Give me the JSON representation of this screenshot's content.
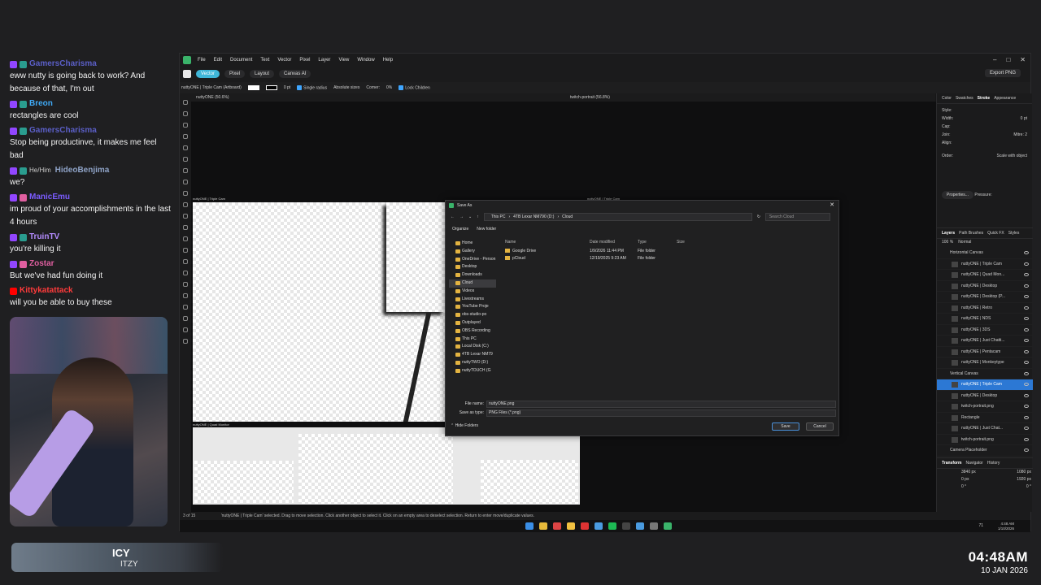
{
  "chat": [
    {
      "user": "GamersCharisma",
      "color": "#5b5fc7",
      "badges": [
        "twitch",
        "sub"
      ],
      "text": "eww nutty is going back to work? And because of that, I'm out"
    },
    {
      "user": "Breon",
      "color": "#3fa9f5",
      "badges": [
        "twitch",
        "sub"
      ],
      "text": "rectangles are cool"
    },
    {
      "user": "GamersCharisma",
      "color": "#5b5fc7",
      "badges": [
        "twitch",
        "sub"
      ],
      "text": "Stop being productinve, it makes me feel bad"
    },
    {
      "user": "HideoBenjima",
      "color": "#8fa3c7",
      "pronoun": "He/Him",
      "badges": [
        "twitch",
        "sub"
      ],
      "text": "we?"
    },
    {
      "user": "ManicEmu",
      "color": "#7b5cff",
      "badges": [
        "twitch",
        "pr"
      ],
      "text": "im proud of your accomplishments in the last 4 hours"
    },
    {
      "user": "TruinTV",
      "color": "#b48cff",
      "badges": [
        "twitch",
        "sub"
      ],
      "text": "you're killing it"
    },
    {
      "user": "Zostar",
      "color": "#e05fa0",
      "badges": [
        "twitch",
        "pr"
      ],
      "text": "But we've had fun doing it"
    },
    {
      "user": "Kittykatattack",
      "color": "#ff3b3b",
      "badges": [
        "yt"
      ],
      "text": "will you be able to buy these"
    }
  ],
  "now_playing": {
    "title": "ICY",
    "artist": "ITZY"
  },
  "clock": {
    "time": "04:48AM",
    "date": "10 JAN 2026"
  },
  "app": {
    "menu": [
      "File",
      "Edit",
      "Document",
      "Text",
      "Vector",
      "Pixel",
      "Layer",
      "View",
      "Window",
      "Help"
    ],
    "personas": [
      "Vector",
      "Pixel",
      "Layout",
      "Canvas AI"
    ],
    "export_label": "Export PNG",
    "context": {
      "selection": "nuttyONE | Triple Cam (Artboard)",
      "stroke": "0 pt",
      "single_radius": "Single radius",
      "absolute_sizes": "Absolute sizes",
      "corner": "Corner:",
      "pct": "0%",
      "lock_children": "Lock Children"
    },
    "tabs": [
      "nuttyONE (50.6%)",
      "twitch-portrait (56.8%)"
    ],
    "artboard_labels": [
      "nuttyONE | Triple Cam",
      "nuttyONE | Triple Cam",
      "nuttyONE | Quad Monitor"
    ],
    "right_tabs_top": [
      "Color",
      "Swatches",
      "Stroke",
      "Appearance"
    ],
    "right_tabs_layers": [
      "Layers",
      "Path Brushes",
      "Quick FX",
      "Styles"
    ],
    "stroke_panel": {
      "style": "Style:",
      "width": "Width:",
      "width_val": "0 pt",
      "cap": "Cap:",
      "join": "Join:",
      "mitre": "Mitre:",
      "mitre_val": "2",
      "align": "Align:",
      "order": "Order:",
      "scale": "Scale with object",
      "properties": "Properties...",
      "pressure": "Pressure:"
    },
    "layers_opacity": "100 %",
    "layers_blend": "Normal",
    "layers": [
      {
        "name": "Horizontal Canvas",
        "group": true,
        "selected": false
      },
      {
        "name": "nuttyONE | Triple Cam",
        "group": false,
        "selected": false
      },
      {
        "name": "nuttyONE | Quad Mon...",
        "group": false,
        "selected": false
      },
      {
        "name": "nuttyONE | Desktop",
        "group": false,
        "selected": false
      },
      {
        "name": "nuttyONE | Desktop (P...",
        "group": false,
        "selected": false
      },
      {
        "name": "nuttyONE | Retro",
        "group": false,
        "selected": false
      },
      {
        "name": "nuttyONE | NDS",
        "group": false,
        "selected": false
      },
      {
        "name": "nuttyONE | 3DS",
        "group": false,
        "selected": false
      },
      {
        "name": "nuttyONE | Just Chatti...",
        "group": false,
        "selected": false
      },
      {
        "name": "nuttyONE | Pentacam",
        "group": false,
        "selected": false
      },
      {
        "name": "nuttyONE | Monkeytype",
        "group": false,
        "selected": false
      },
      {
        "name": "Vertical Canvas",
        "group": true,
        "selected": false
      },
      {
        "name": "nuttyONE | Triple Cam",
        "group": false,
        "selected": true
      },
      {
        "name": "nuttyONE | Desktop",
        "group": false,
        "selected": false
      },
      {
        "name": "twitch-portrait.png",
        "group": false,
        "selected": false
      },
      {
        "name": "Rectangle",
        "group": false,
        "selected": false
      },
      {
        "name": "nuttyONE | Just Chat...",
        "group": false,
        "selected": false
      },
      {
        "name": "twitch-portrait.png",
        "group": false,
        "selected": false
      },
      {
        "name": "Camera Placeholder",
        "group": true,
        "selected": false
      }
    ],
    "transform_tabs": [
      "Transform",
      "Navigator",
      "History"
    ],
    "transform": {
      "x": "3840 px",
      "w": "1080 px",
      "y": "0 px",
      "h": "1920 px",
      "r": "0 °",
      "s": "0 °"
    },
    "status": {
      "pages": "3 of 15",
      "text": "'nuttyONE | Triple Cam' selected. Drag to move selection. Click another object to select it. Click on an empty area to deselect selection. Return to enter move/duplicate values."
    },
    "taskbar_time": "4:48 AM",
    "taskbar_date": "1/10/2026",
    "taskbar_num": "71"
  },
  "dialog": {
    "title": "Save As",
    "path": [
      "This PC",
      "4TB Lexar NM790 (D:)",
      "Cloud"
    ],
    "search_placeholder": "Search Cloud",
    "organize": "Organize",
    "new_folder": "New folder",
    "sidebar": [
      {
        "label": "Home",
        "current": false
      },
      {
        "label": "Gallery",
        "current": false
      },
      {
        "label": "OneDrive - Person",
        "current": false
      },
      {
        "label": "Desktop",
        "current": false
      },
      {
        "label": "Downloads",
        "current": false
      },
      {
        "label": "Cloud",
        "current": true
      },
      {
        "label": "Videos",
        "current": false
      },
      {
        "label": "Livestreams",
        "current": false
      },
      {
        "label": "YouTube Proje",
        "current": false
      },
      {
        "label": "obs-studio-po",
        "current": false
      },
      {
        "label": "Outplayed",
        "current": false
      },
      {
        "label": "OBS Recording",
        "current": false
      },
      {
        "label": "This PC",
        "current": false
      },
      {
        "label": "Local Disk (C:)",
        "current": false
      },
      {
        "label": "4TB Lexar NM79",
        "current": false
      },
      {
        "label": "nuttyTWO (D:)",
        "current": false
      },
      {
        "label": "nuttyTOUCH (G",
        "current": false
      }
    ],
    "columns": [
      "Name",
      "Date modified",
      "Type",
      "Size"
    ],
    "files": [
      {
        "name": "Google Drive",
        "date": "1/9/2026 11:44 PM",
        "type": "File folder",
        "size": ""
      },
      {
        "name": "pCloud",
        "date": "12/19/2025 9:23 AM",
        "type": "File folder",
        "size": ""
      }
    ],
    "file_name_label": "File name:",
    "file_name": "nuttyONE.png",
    "type_label": "Save as type:",
    "type_value": "PNG Files (*.png)",
    "hide_folders": "Hide Folders",
    "save": "Save",
    "cancel": "Cancel"
  }
}
